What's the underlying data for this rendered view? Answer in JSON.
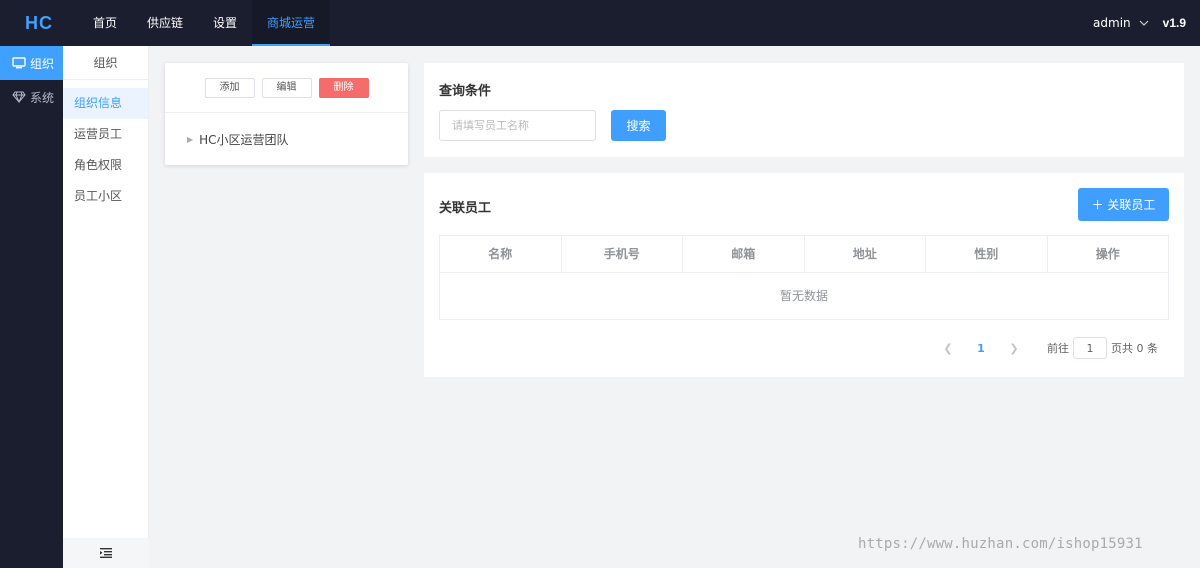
{
  "logo": "HC",
  "topnav": [
    {
      "label": "首页",
      "active": false
    },
    {
      "label": "供应链",
      "active": false
    },
    {
      "label": "设置",
      "active": false
    },
    {
      "label": "商城运营",
      "active": true
    }
  ],
  "user": {
    "name": "admin",
    "version": "v1.9"
  },
  "iconbar": [
    {
      "label": "组织",
      "icon": "monitor-icon",
      "active": true
    },
    {
      "label": "系统",
      "icon": "diamond-icon",
      "active": false
    }
  ],
  "subbar": {
    "title": "组织",
    "items": [
      {
        "label": "组织信息",
        "active": true
      },
      {
        "label": "运营员工",
        "active": false
      },
      {
        "label": "角色权限",
        "active": false
      },
      {
        "label": "员工小区",
        "active": false
      }
    ]
  },
  "tree": {
    "add_label": "添加",
    "edit_label": "编辑",
    "delete_label": "删除",
    "root_node": "HC小区运营团队"
  },
  "query": {
    "title": "查询条件",
    "placeholder": "请填写员工名称",
    "value": "",
    "search_label": "搜索"
  },
  "staff": {
    "title": "关联员工",
    "add_label": "关联员工",
    "columns": [
      "名称",
      "手机号",
      "邮箱",
      "地址",
      "性别",
      "操作"
    ],
    "empty_text": "暂无数据"
  },
  "pager": {
    "current": "1",
    "goto_label": "前往",
    "input_value": "1",
    "total_label": "页共 0 条"
  },
  "watermark": "https://www.huzhan.com/ishop15931",
  "colors": {
    "primary": "#409eff",
    "danger": "#f56c6c",
    "dark": "#1b1e2e"
  }
}
